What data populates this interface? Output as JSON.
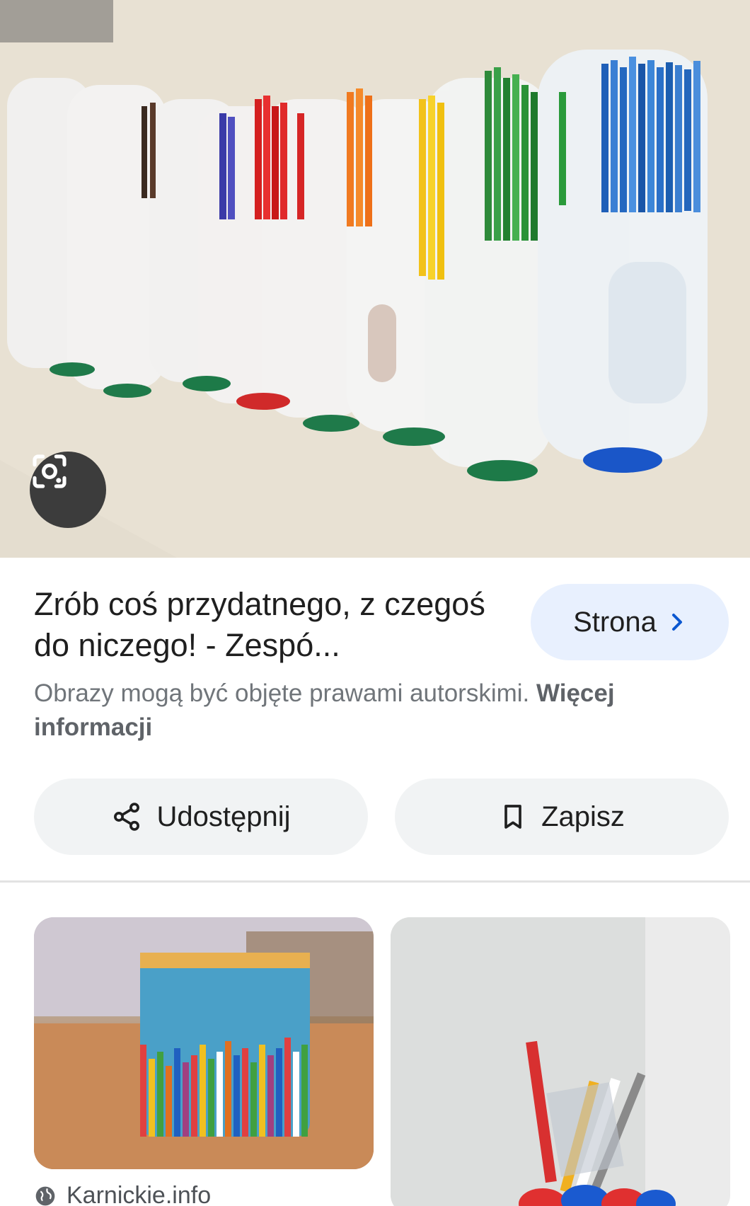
{
  "result": {
    "title": "Zrób coś przydatnego, z czegoś do niczego! - Zespó...",
    "visit_label": "Strona",
    "copyright_text": "Obrazy mogą być objęte prawami autorskimi.",
    "copyright_more": "Więcej informacji"
  },
  "actions": {
    "share_label": "Udostępnij",
    "save_label": "Zapisz"
  },
  "related": {
    "first_source": "Karnickie.info"
  },
  "icons": {
    "lens": "google-lens-icon",
    "visit": "chevron-right-icon",
    "share": "share-icon",
    "save": "bookmark-icon",
    "source": "globe-icon"
  },
  "colors": {
    "visit_button_bg": "#e8f0fe",
    "action_button_bg": "#f1f3f4",
    "link_chevron": "#0b57d0"
  }
}
